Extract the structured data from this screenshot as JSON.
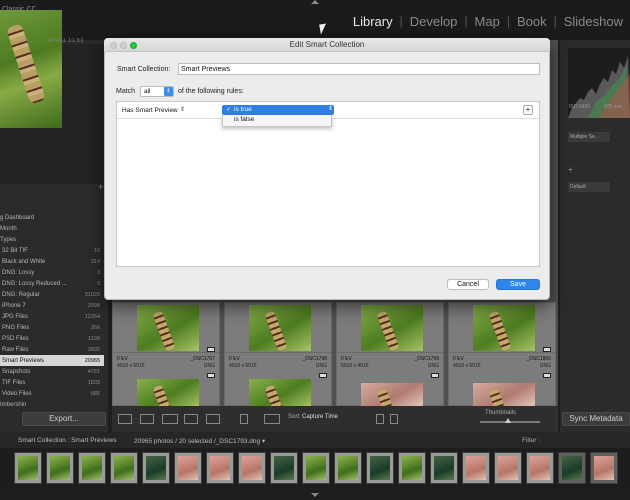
{
  "app": {
    "title": "Classic CC"
  },
  "modules": [
    {
      "label": "Library",
      "active": true
    },
    {
      "label": "Develop",
      "active": false
    },
    {
      "label": "Map",
      "active": false
    },
    {
      "label": "Book",
      "active": false
    },
    {
      "label": "Slideshow",
      "active": false
    }
  ],
  "navigator": {
    "zoom_labels": "FIT  FILL  1:1  3:1"
  },
  "collections": [
    {
      "label": "g Dashboard",
      "count": ""
    },
    {
      "label": "Month",
      "count": ""
    },
    {
      "label": "Types",
      "count": ""
    },
    {
      "label": "32 Bit TIF",
      "count": "19"
    },
    {
      "label": "Black and White",
      "count": "314"
    },
    {
      "label": "DNG: Lossy",
      "count": "3"
    },
    {
      "label": "DNG: Lossy Reduced ...",
      "count": "0"
    },
    {
      "label": "DNG: Regular",
      "count": "31028"
    },
    {
      "label": "iPhone 7",
      "count": "2098"
    },
    {
      "label": "JPG Files",
      "count": "12264"
    },
    {
      "label": "PNG Files",
      "count": "266"
    },
    {
      "label": "PSD Files",
      "count": "1109"
    },
    {
      "label": "Raw Files",
      "count": "2892"
    },
    {
      "label": "Smart Previews",
      "count": "20965",
      "selected": true
    },
    {
      "label": "Snapshots",
      "count": "4761"
    },
    {
      "label": "TIF Files",
      "count": "1833"
    },
    {
      "label": "Video Files",
      "count": "685"
    },
    {
      "label": "Imbershin",
      "count": ""
    }
  ],
  "left_panel": {
    "export_label": "Export..."
  },
  "right_panel": {
    "iso": "ISO 6400",
    "focal": "105 mm",
    "multiple_select": "Multiple Se...",
    "default_select": "Default",
    "sync_label": "Sync Metadata"
  },
  "grid": {
    "top_row": [
      {
        "badge": true
      },
      {
        "badge": false
      },
      {
        "badge": false
      },
      {
        "badge": true
      }
    ],
    "cells": [
      {
        "ev": "0 EV",
        "fname": "_DSC1797",
        "dims": "4016 x 6016",
        "ftype": "DNG"
      },
      {
        "ev": "0 EV",
        "fname": "_DSC1798",
        "dims": "4016 x 6016",
        "ftype": "DNG"
      },
      {
        "ev": "0 EV",
        "fname": "_DSC1799",
        "dims": "6016 x 4016",
        "ftype": "DNG"
      },
      {
        "ev": "0 EV",
        "fname": "_DSC1800",
        "dims": "4016 x 6016",
        "ftype": "DNG"
      }
    ]
  },
  "toolbar": {
    "sort_label": "Sort:",
    "sort_value": "Capture Time",
    "thumbnails_label": "Thumbnails"
  },
  "filmstrip": {
    "source": "Smart Collection : Smart Previews",
    "count": "20965 photos / 20 selected /_DSC1793.dng ▾",
    "filter_label": "Filter :"
  },
  "dialog": {
    "title": "Edit Smart Collection",
    "smart_collection_label": "Smart Collection:",
    "smart_collection_value": "Smart Previews",
    "match_label": "Match",
    "match_value": "all",
    "match_suffix": "of the following rules:",
    "rule_field": "Has Smart Preview",
    "rule_operator_selected": "is true",
    "rule_operator_other": "is false",
    "add_rule": "+",
    "cancel_label": "Cancel",
    "save_label": "Save"
  },
  "colors": {
    "accent_blue": "#2f7ee6",
    "zoom_green": "#28c93f",
    "panel_bg": "#2b2b2b",
    "grid_bg": "#505050"
  }
}
